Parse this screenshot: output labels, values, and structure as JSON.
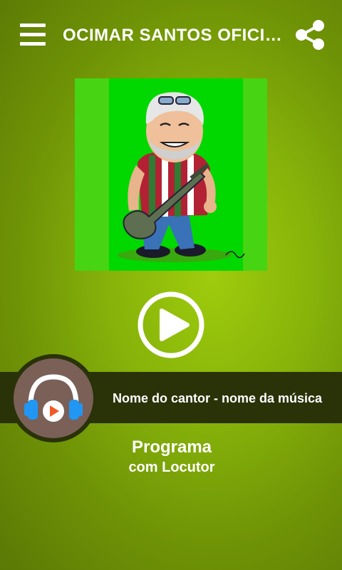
{
  "header": {
    "title": "OCIMAR SANTOS OFICIAL",
    "menu_icon": "hamburger-menu-icon",
    "share_icon": "share-icon"
  },
  "cover": {
    "art": "caricature-singer-with-guitar",
    "background_color": "#47d412"
  },
  "player": {
    "play_icon": "play-icon"
  },
  "now_playing": {
    "text": "Nome do cantor - nome da música",
    "logo_icon": "headphones-play-icon"
  },
  "program": {
    "name": "Programa",
    "host": "com Locutor"
  },
  "colors": {
    "background": "#86b20a",
    "bar": "#2a3208",
    "logo_circle": "#7a6057",
    "headphone_blue": "#2196f3",
    "play_orange": "#f15a24"
  }
}
